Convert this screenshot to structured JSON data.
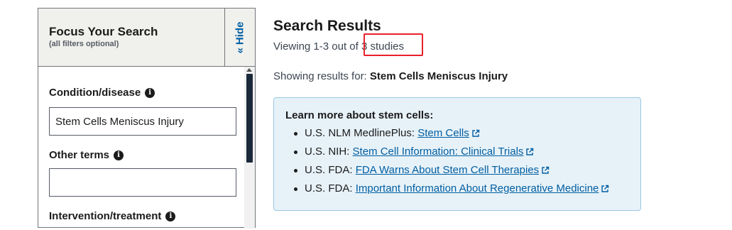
{
  "filter_panel": {
    "title": "Focus Your Search",
    "subtitle": "(all filters optional)",
    "hide_label": "Hide",
    "fields": [
      {
        "label": "Condition/disease",
        "value": "Stem Cells Meniscus Injury"
      },
      {
        "label": "Other terms",
        "value": ""
      },
      {
        "label": "Intervention/treatment"
      }
    ]
  },
  "results": {
    "title": "Search Results",
    "viewing_prefix": "Viewing 1-3 out of",
    "viewing_count": "3 studies",
    "showing_prefix": "Showing results for:",
    "query": "Stem Cells Meniscus Injury"
  },
  "stem_info": {
    "heading": "Learn more about stem cells:",
    "items": [
      {
        "source": "U.S. NLM MedlinePlus:",
        "link": "Stem Cells"
      },
      {
        "source": "U.S. NIH:",
        "link": "Stem Cell Information: Clinical Trials"
      },
      {
        "source": "U.S. FDA:",
        "link": "FDA Warns About Stem Cell Therapies"
      },
      {
        "source": "U.S. FDA:",
        "link": "Important Information About Regenerative Medicine"
      }
    ]
  },
  "colors": {
    "link": "#005ea2",
    "highlight_border": "#e8212b",
    "info_box_bg": "#e7f2f8",
    "panel_header_bg": "#f0f0ec"
  },
  "icons": [
    "info-icon",
    "chevron-double-left-icon",
    "external-link-icon"
  ]
}
